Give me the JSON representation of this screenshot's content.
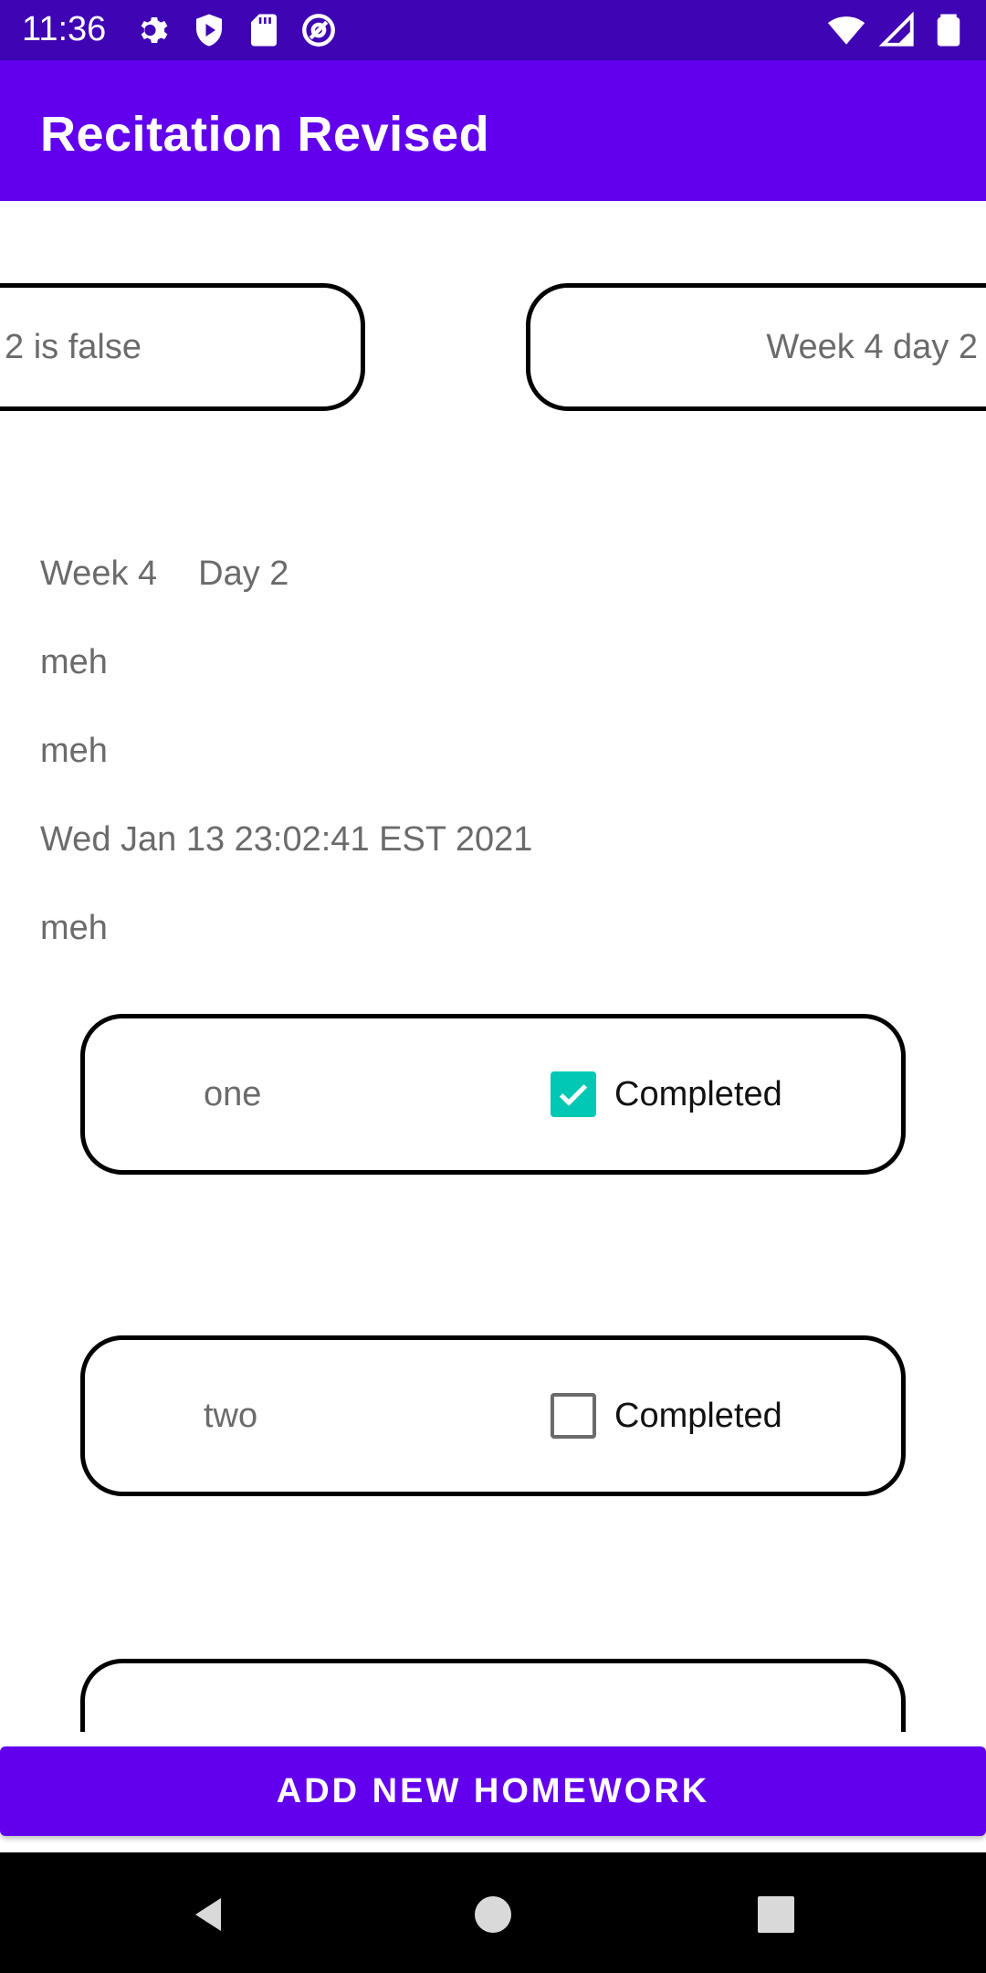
{
  "status_bar": {
    "time": "11:36",
    "left_icons": [
      "gear-icon",
      "shield-play-icon",
      "sd-card-icon",
      "at-sign-icon"
    ],
    "right_icons": [
      "wifi-icon",
      "signal-icon",
      "battery-icon"
    ],
    "background": "#3f04b3"
  },
  "app_bar": {
    "title": "Recitation Revised",
    "background": "#6200ee"
  },
  "pager": {
    "left_card_text": "2 is false",
    "right_card_text": "Week 4 day 2"
  },
  "details": {
    "week": "Week 4",
    "day": "Day 2",
    "line2": "meh",
    "line3": "meh",
    "date": "Wed Jan 13 23:02:41 EST 2021",
    "line5": "meh"
  },
  "homework": [
    {
      "name": "one",
      "completed_label": "Completed",
      "checked": true
    },
    {
      "name": "two",
      "completed_label": "Completed",
      "checked": false
    }
  ],
  "add_button": {
    "label": "ADD NEW HOMEWORK"
  },
  "colors": {
    "accent": "#6200ee",
    "checkbox_checked": "#00c8b4"
  }
}
